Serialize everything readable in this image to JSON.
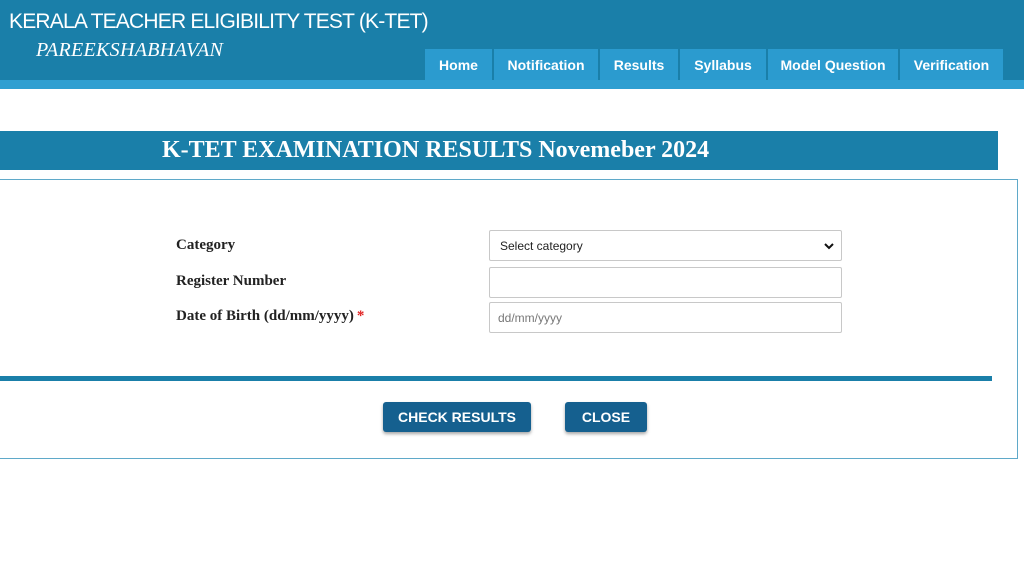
{
  "header": {
    "title": "KERALA TEACHER ELIGIBILITY TEST (K-TET)",
    "subtitle": "PAREEKSHABHAVAN"
  },
  "nav": {
    "items": [
      {
        "label": "Home"
      },
      {
        "label": "Notification"
      },
      {
        "label": "Results"
      },
      {
        "label": "Syllabus"
      },
      {
        "label": "Model Question"
      },
      {
        "label": "Verification"
      }
    ]
  },
  "banner": {
    "title": "K-TET EXAMINATION RESULTS Novemeber 2024"
  },
  "form": {
    "category": {
      "label": "Category",
      "value": "Select category",
      "icon": "chevron-down-icon"
    },
    "register_number": {
      "label": "Register Number",
      "value": "",
      "placeholder": ""
    },
    "dob": {
      "label": "Date of Birth (dd/mm/yyyy)",
      "required_mark": "*",
      "value": "",
      "placeholder": "dd/mm/yyyy"
    }
  },
  "buttons": {
    "check_results": "CHECK RESULTS",
    "close": "CLOSE"
  },
  "colors": {
    "header_bg": "#1a7fa9",
    "nav_tab_bg": "#2b9bcf",
    "button_bg": "#15608f",
    "required": "#e02020"
  }
}
